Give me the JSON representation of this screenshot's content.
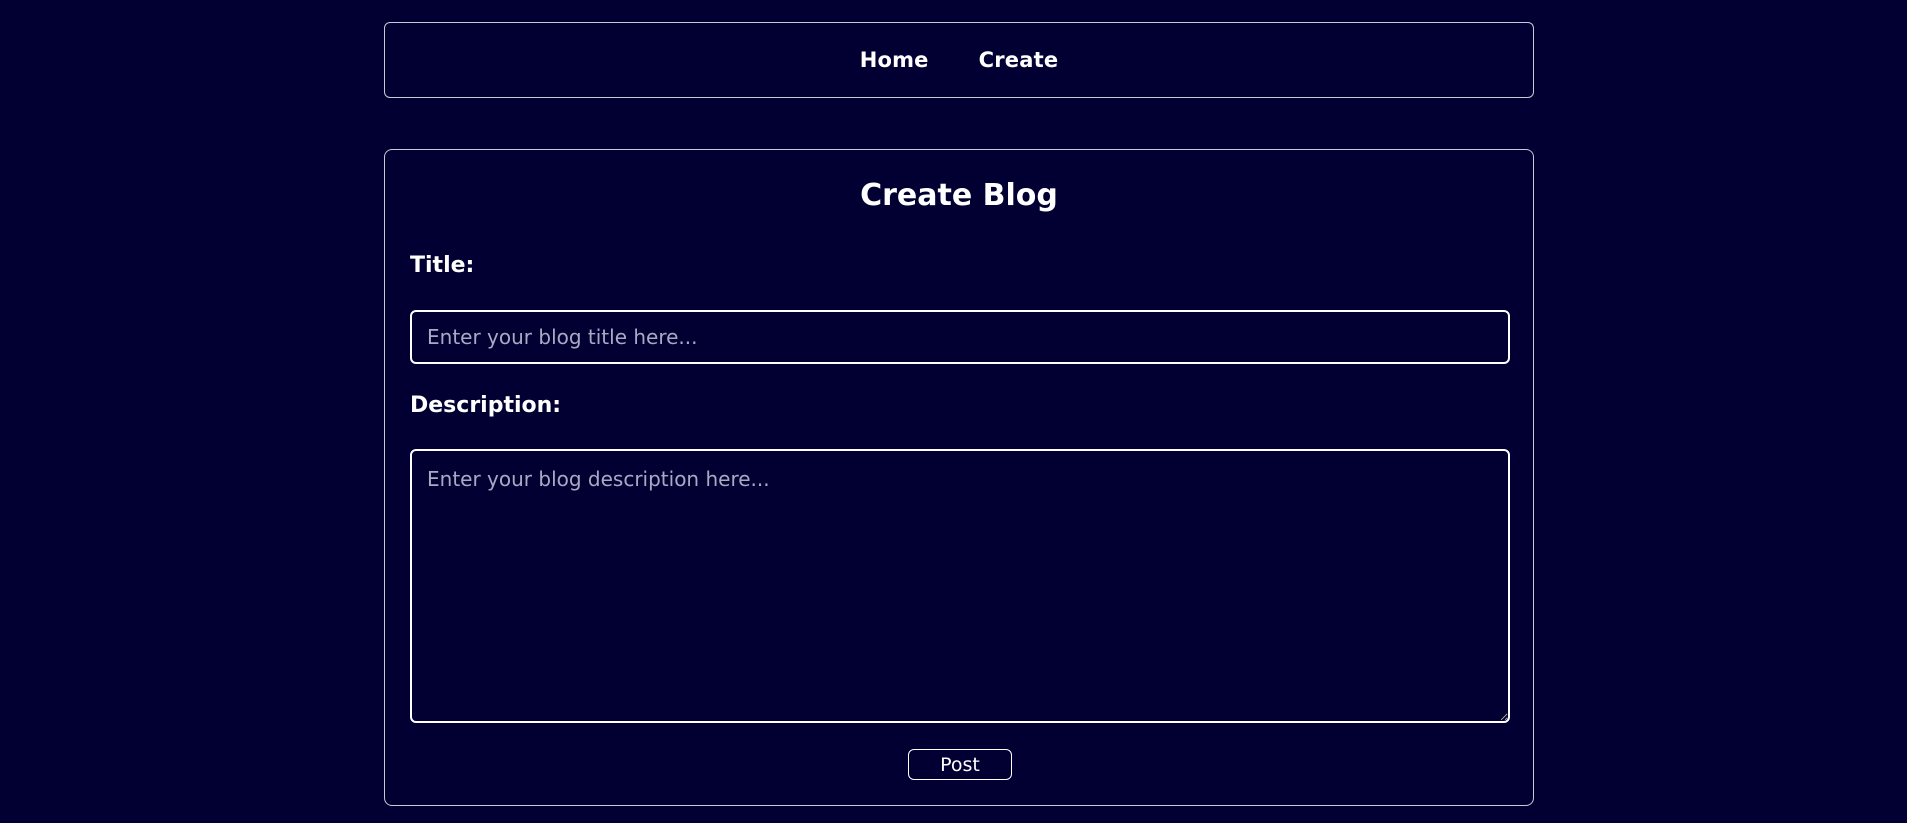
{
  "nav": {
    "items": [
      {
        "label": "Home"
      },
      {
        "label": "Create"
      }
    ]
  },
  "form": {
    "heading": "Create Blog",
    "title_label": "Title:",
    "title_placeholder": "Enter your blog title here...",
    "title_value": "",
    "description_label": "Description:",
    "description_placeholder": "Enter your blog description here...",
    "description_value": "",
    "post_label": "Post"
  },
  "colors": {
    "background": "#020033",
    "text": "#ffffff",
    "border": "#c9c9d6",
    "placeholder": "#a9a9c4"
  }
}
